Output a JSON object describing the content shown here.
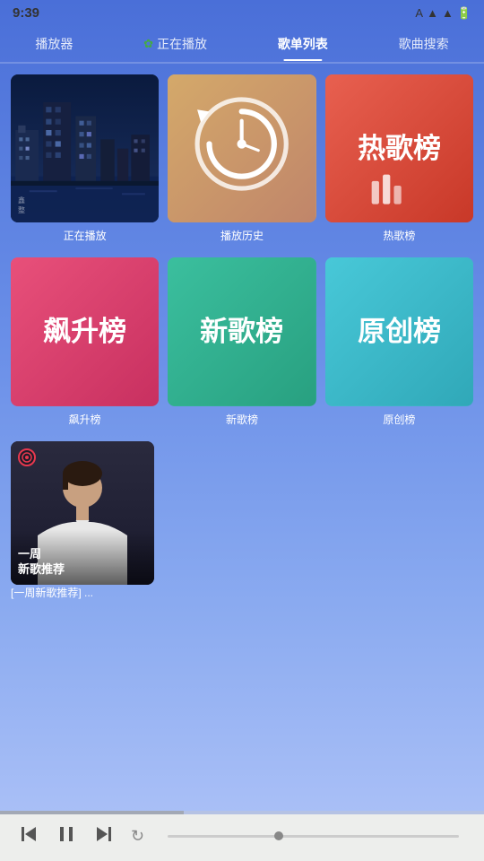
{
  "statusBar": {
    "time": "9:39",
    "icons": [
      "A",
      "wifi",
      "signal",
      "battery"
    ]
  },
  "nav": {
    "items": [
      {
        "id": "player",
        "label": "播放器",
        "active": false
      },
      {
        "id": "nowplaying",
        "label": "正在播放",
        "active": false,
        "hasIcon": true
      },
      {
        "id": "playlist",
        "label": "歌单列表",
        "active": true
      },
      {
        "id": "search",
        "label": "歌曲搜索",
        "active": false
      }
    ]
  },
  "grid": {
    "row1": [
      {
        "id": "nowplaying",
        "label": "正在播放"
      },
      {
        "id": "history",
        "label": "播放历史"
      },
      {
        "id": "hot",
        "label": "热歌榜"
      }
    ],
    "row2": [
      {
        "id": "rising",
        "label": "飙升榜"
      },
      {
        "id": "newsongs",
        "label": "新歌榜"
      },
      {
        "id": "original",
        "label": "原创榜"
      }
    ]
  },
  "weekly": {
    "label": "[一周新歌推荐] ...",
    "overlayLine1": "一周",
    "overlayLine2": "新歌推荐"
  },
  "player": {
    "progress": 38
  }
}
